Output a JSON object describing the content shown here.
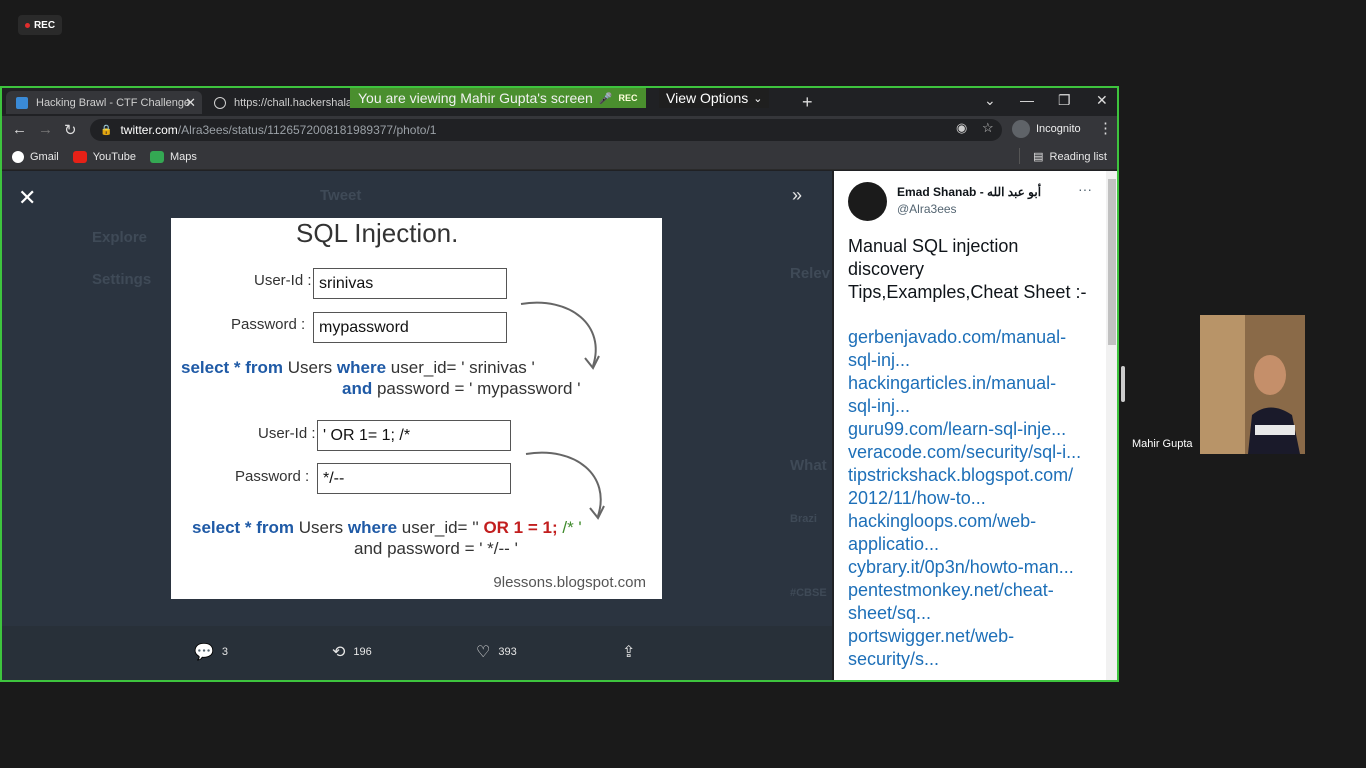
{
  "recording": {
    "label": "REC"
  },
  "tabs": [
    {
      "title": "Hacking Brawl - CTF Challenge"
    },
    {
      "title": "https://chall.hackershala.co"
    }
  ],
  "share_banner": {
    "text": "You are viewing Mahir Gupta's screen",
    "rec": "REC",
    "view_options": "View Options"
  },
  "address": {
    "domain": "twitter.com",
    "path": "/Alra3ees/status/1126572008181989377/photo/1",
    "incognito": "Incognito"
  },
  "bookmarks": {
    "items": [
      "Gmail",
      "YouTube",
      "Maps"
    ],
    "reading_list": "Reading list"
  },
  "background_nav": {
    "tweet_header": "Tweet",
    "explore": "Explore",
    "settings": "Settings",
    "relevant": "Relev",
    "whats": "What",
    "brazil": "Brazi",
    "cbse": "#CBSE"
  },
  "photo": {
    "title": "SQL Injection.",
    "user_id_label": "User-Id :",
    "password_label": "Password :",
    "user_id_value_1": "srinivas",
    "password_value_1": "mypassword",
    "query1_line1_select": "select * from",
    "query1_line1_users": "Users",
    "query1_line1_where": "where",
    "query1_line1_rest": "user_id= ' srinivas '",
    "query1_line2_and": "and",
    "query1_line2_rest": "password = ' mypassword '",
    "user_id_value_2": "' OR 1= 1; /*",
    "password_value_2": "*/--",
    "query2_line1_select": "select * from",
    "query2_line1_users": "Users",
    "query2_line1_where": "where",
    "query2_line1_rest": "user_id= ''",
    "query2_or": "OR 1 = 1;",
    "query2_comment": "/* '",
    "query2_line2": "and password = ' */-- '",
    "source": "9lessons.blogspot.com"
  },
  "actions": {
    "replies": "3",
    "retweets": "196",
    "likes": "393"
  },
  "tweet": {
    "name": "Emad Shanab - أبو عبد الله",
    "handle": "@Alra3ees",
    "body": "Manual SQL injection discovery Tips,Examples,Cheat Sheet :-",
    "links": [
      "gerbenjavado.com/manual-",
      "sql-inj...",
      "hackingarticles.in/manual-",
      "sql-inj...",
      "guru99.com/learn-sql-inje...",
      "veracode.com/security/sql-i...",
      "tipstrickshack.blogspot.com/",
      "2012/11/how-to...",
      "hackingloops.com/web-",
      "applicatio...",
      "cybrary.it/0p3n/howto-man...",
      "pentestmonkey.net/cheat-",
      "sheet/sq...",
      "portswigger.net/web-",
      "security/s..."
    ]
  },
  "participant": {
    "name": "Mahir Gupta"
  }
}
